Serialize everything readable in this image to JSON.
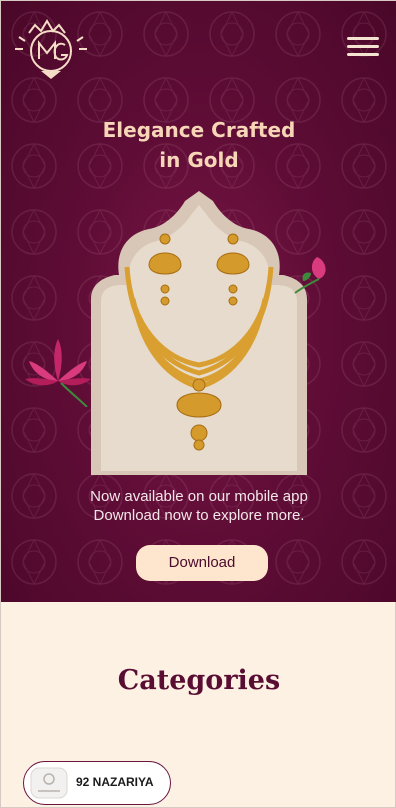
{
  "header": {
    "logo_icon": "mg-monogram-logo",
    "menu_icon": "hamburger-menu-icon"
  },
  "hero": {
    "title_line1": "Elegance Crafted",
    "title_line2": "in Gold",
    "subtitle_line1": "Now available on our mobile app",
    "subtitle_line2": "Download now to explore more.",
    "download_label": "Download",
    "image": "gold-necklace-and-earrings-set"
  },
  "categories": {
    "title": "Categories",
    "items": [
      {
        "label": "92 NAZARIYA",
        "icon": "jewelry-thumbnail"
      }
    ]
  },
  "colors": {
    "hero_bg": "#5f0d36",
    "title_gold": "#f6d6b6",
    "button_bg": "#fde6cd",
    "page_bg": "#fdf1e4",
    "heading": "#5a0d32"
  }
}
